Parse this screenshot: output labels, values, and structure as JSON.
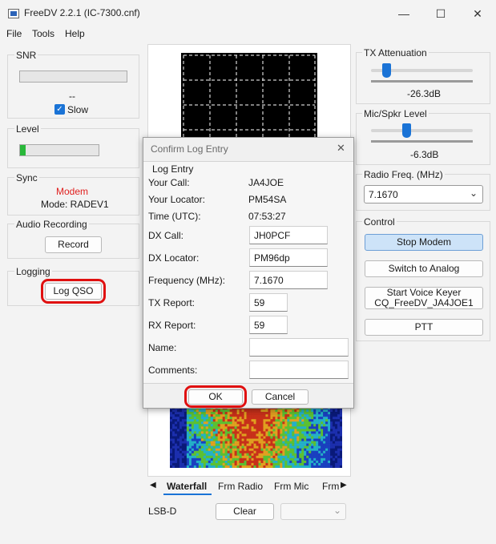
{
  "window": {
    "title": "FreeDV 2.2.1 (IC-7300.cnf)",
    "min_glyph": "—",
    "max_glyph": "☐",
    "close_glyph": "✕"
  },
  "menu": {
    "file": "File",
    "tools": "Tools",
    "help": "Help"
  },
  "snr": {
    "label": "SNR",
    "value": "--",
    "slow_label": "Slow",
    "slow_checked": true
  },
  "level": {
    "label": "Level",
    "fill_fraction": 0.07
  },
  "sync": {
    "label": "Sync",
    "modem_text": "Modem",
    "modem_color": "#e0201f",
    "mode_text": "Mode: RADEV1"
  },
  "audio_recording": {
    "label": "Audio Recording",
    "record_button": "Record"
  },
  "logging": {
    "label": "Logging",
    "log_qso_button": "Log QSO"
  },
  "tx_attenuation": {
    "label": "TX Attenuation",
    "value": "-26.3dB",
    "slider_fraction": 0.15
  },
  "mic_spkr": {
    "label": "Mic/Spkr Level",
    "value": "-6.3dB",
    "slider_fraction": 0.35
  },
  "radio_freq": {
    "label": "Radio Freq. (MHz)",
    "value": "7.1670",
    "chevron": "⌄"
  },
  "control": {
    "label": "Control",
    "stop_modem": "Stop Modem",
    "switch_analog": "Switch to Analog",
    "voice_keyer_line1": "Start Voice Keyer",
    "voice_keyer_line2": "CQ_FreeDV_JA4JOE1",
    "ptt": "PTT"
  },
  "tabs": {
    "left_arrow": "◀",
    "right_arrow": "▶",
    "items": [
      "Waterfall",
      "Frm Radio",
      "Frm Mic",
      "Frm"
    ],
    "active": "Waterfall"
  },
  "bottom": {
    "mode": "LSB-D",
    "clear_button": "Clear"
  },
  "dialog": {
    "title": "Confirm Log Entry",
    "close_glyph": "✕",
    "section": "Log Entry",
    "your_call_label": "Your Call:",
    "your_call": "JA4JOE",
    "your_locator_label": "Your Locator:",
    "your_locator": "PM54SA",
    "time_label": "Time (UTC):",
    "time": "07:53:27",
    "dx_call_label": "DX Call:",
    "dx_call": "JH0PCF",
    "dx_locator_label": "DX Locator:",
    "dx_locator": "PM96dp",
    "frequency_label": "Frequency (MHz):",
    "frequency": "7.1670",
    "tx_report_label": "TX Report:",
    "tx_report": "59",
    "rx_report_label": "RX Report:",
    "rx_report": "59",
    "name_label": "Name:",
    "name": "",
    "comments_label": "Comments:",
    "comments": "",
    "ok_button": "OK",
    "cancel_button": "Cancel"
  },
  "colors": {
    "highlight_ring": "#e01010",
    "accent_blue": "#1a73d6",
    "button_primary_bg": "#cde3f8"
  }
}
